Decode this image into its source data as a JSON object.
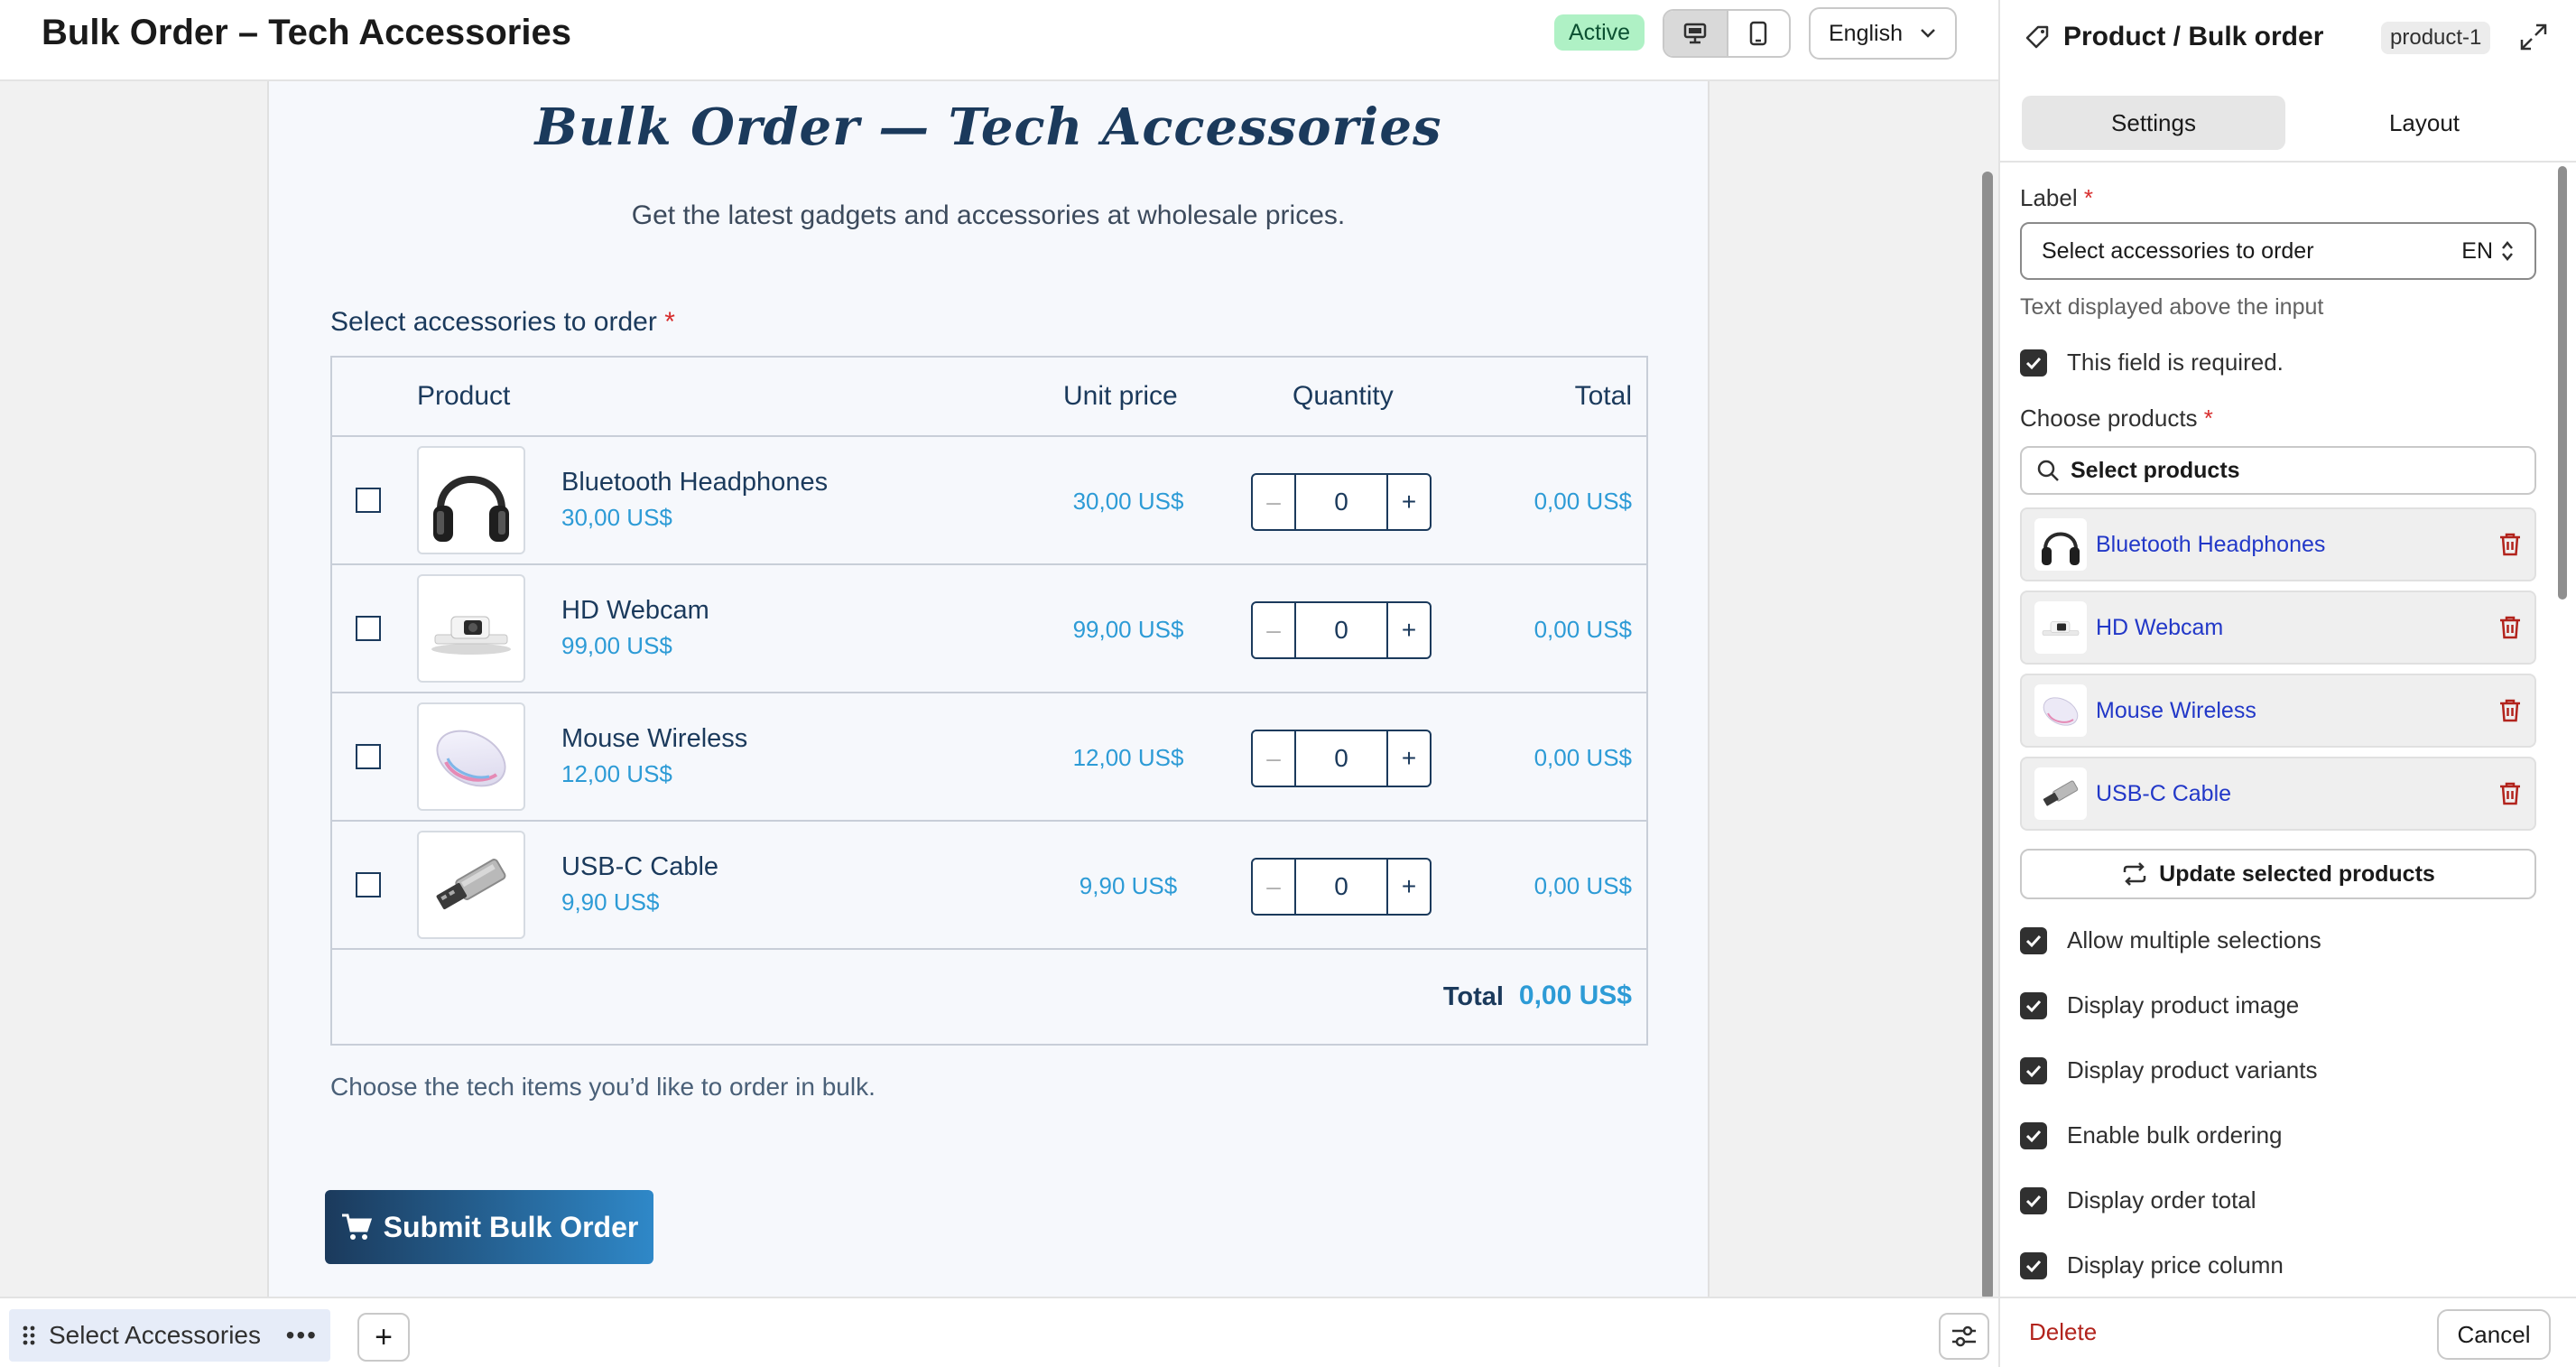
{
  "header": {
    "title": "Bulk Order – Tech Accessories",
    "status": "Active",
    "language": "English"
  },
  "form": {
    "title": "Bulk Order — Tech Accessories",
    "subtitle": "Get the latest gadgets and accessories at wholesale prices.",
    "field_label": "Select accessories to order",
    "required_mark": "*",
    "columns": {
      "product": "Product",
      "unit_price": "Unit price",
      "quantity": "Quantity",
      "total": "Total"
    },
    "rows": [
      {
        "name": "Bluetooth Headphones",
        "price": "30,00 US$",
        "unit_price": "30,00 US$",
        "qty": "0",
        "total": "0,00 US$",
        "icon": "headphones-icon"
      },
      {
        "name": "HD Webcam",
        "price": "99,00 US$",
        "unit_price": "99,00 US$",
        "qty": "0",
        "total": "0,00 US$",
        "icon": "webcam-icon"
      },
      {
        "name": "Mouse Wireless",
        "price": "12,00 US$",
        "unit_price": "12,00 US$",
        "qty": "0",
        "total": "0,00 US$",
        "icon": "mouse-icon"
      },
      {
        "name": "USB-C Cable",
        "price": "9,90 US$",
        "unit_price": "9,90 US$",
        "qty": "0",
        "total": "0,00 US$",
        "icon": "usb-cable-icon"
      }
    ],
    "stepper": {
      "minus": "–",
      "plus": "+"
    },
    "footer_total_label": "Total",
    "footer_total_value": "0,00 US$",
    "help_text": "Choose the tech items you’d like to order in bulk.",
    "submit_label": "Submit Bulk Order"
  },
  "bottombar": {
    "section_label": "Select Accessories",
    "more": "•••",
    "add": "+"
  },
  "panel": {
    "title": "Product / Bulk order",
    "id_badge": "product-1",
    "tabs": [
      "Settings",
      "Layout"
    ],
    "label_field_label": "Label",
    "label_value": "Select accessories to order",
    "label_lang": "EN",
    "label_help": "Text displayed above the input",
    "required_checkbox": "This field is required.",
    "choose_products_label": "Choose products",
    "search_placeholder": "Select products",
    "products": [
      "Bluetooth Headphones",
      "HD Webcam",
      "Mouse Wireless",
      "USB-C Cable"
    ],
    "update_button": "Update selected products",
    "options": [
      "Allow multiple selections",
      "Display product image",
      "Display product variants",
      "Enable bulk ordering",
      "Display order total",
      "Display price column"
    ],
    "delete_label": "Delete",
    "cancel_label": "Cancel"
  },
  "colors": {
    "brand_navy": "#1b3a5c",
    "accent_blue": "#2d9bd6",
    "status_green_bg": "#aff1c5",
    "link_blue": "#2238c8",
    "danger_red": "#b2231c"
  }
}
